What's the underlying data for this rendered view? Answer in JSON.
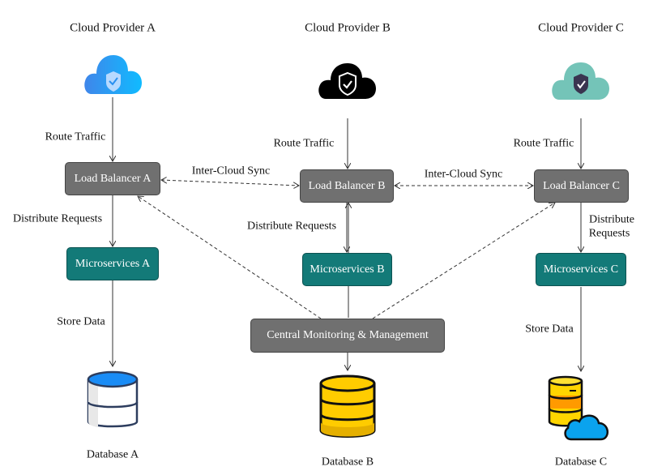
{
  "providers": [
    {
      "title": "Cloud Provider A",
      "load_balancer": "Load Balancer A",
      "microservices": "Microservices A",
      "database": "Database A",
      "cloud_color": "#2a8ff0"
    },
    {
      "title": "Cloud Provider B",
      "load_balancer": "Load Balancer B",
      "microservices": "Microservices B",
      "database": "Database B",
      "cloud_color": "#000000"
    },
    {
      "title": "Cloud Provider C",
      "load_balancer": "Load Balancer C",
      "microservices": "Microservices C",
      "database": "Database C",
      "cloud_color": "#74c4b8"
    }
  ],
  "central": "Central Monitoring & Management",
  "edge_labels": {
    "route_traffic_a": "Route Traffic",
    "route_traffic_b": "Route Traffic",
    "route_traffic_c": "Route Traffic",
    "distribute_a": "Distribute Requests",
    "distribute_b": "Distribute Requests",
    "distribute_c_line1": "Distribute",
    "distribute_c_line2": "Requests",
    "store_a": "Store Data",
    "store_c": "Store Data",
    "sync_ab": "Inter-Cloud Sync",
    "sync_bc": "Inter-Cloud Sync"
  },
  "colors": {
    "load_balancer": "#707070",
    "microservices": "#137a78",
    "central": "#707070"
  }
}
